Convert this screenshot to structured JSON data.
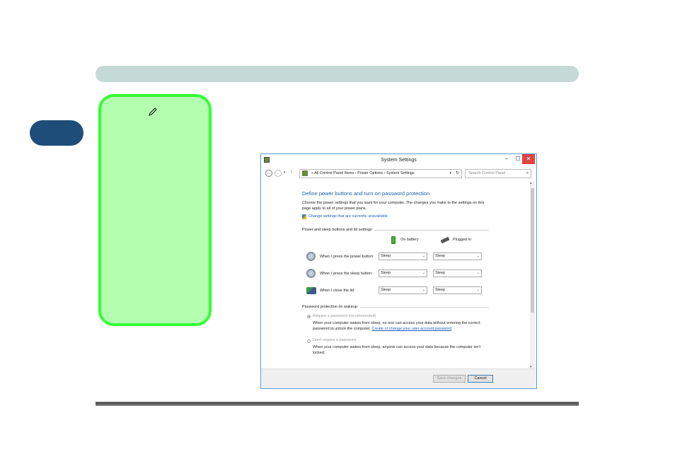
{
  "window": {
    "title": "System Settings",
    "minimize": "–",
    "maximize": "☐",
    "close": "✕"
  },
  "address_bar": {
    "back": "←",
    "forward": "→",
    "dropdown": "▾",
    "up": "↑",
    "path_text": "«  All Control Panel Items  ›  Power Options  ›  System Settings",
    "refresh": "↻",
    "search_placeholder": "Search Control Panel",
    "search_icon": "search-icon"
  },
  "page": {
    "heading": "Define power buttons and turn on password protection",
    "description": "Choose the power settings that you want for your computer. The changes you make to the settings on this page apply to all of your power plans.",
    "change_link": "Change settings that are currently unavailable",
    "group1_label": "Power and sleep buttons and lid settings",
    "col_battery": "On battery",
    "col_plugged": "Plugged in",
    "rows": [
      {
        "label": "When I press the power button:",
        "battery": "Sleep",
        "plugged": "Sleep"
      },
      {
        "label": "When I press the sleep button:",
        "battery": "Sleep",
        "plugged": "Sleep"
      },
      {
        "label": "When I close the lid:",
        "battery": "Sleep",
        "plugged": "Sleep"
      }
    ],
    "group2_label": "Password protection on wakeup",
    "opt1_label": "Require a password (recommended)",
    "opt1_desc": "When your computer wakes from sleep, no one can access your data without entering the correct password to unlock the computer.",
    "opt1_link": "Create or change your user account password",
    "opt2_label": "Don't require a password",
    "opt2_desc": "When your computer wakes from sleep, anyone can access your data because the computer isn't locked."
  },
  "buttons": {
    "save": "Save changes",
    "cancel": "Cancel"
  },
  "colors": {
    "note_fill": "#b4feb0",
    "note_border": "#33ff33",
    "header_bar": "#c5d9d6",
    "side_tab": "#1f4d7a",
    "link": "#1a5cb8"
  }
}
